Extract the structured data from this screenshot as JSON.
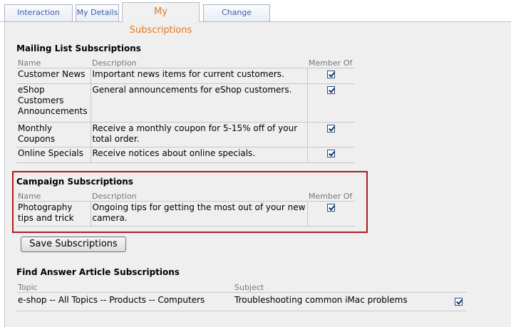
{
  "tabs": [
    {
      "label": "Interaction History"
    },
    {
      "label": "My Details"
    },
    {
      "label": "My Subscriptions"
    },
    {
      "label": "Change Password"
    }
  ],
  "mailing": {
    "title": "Mailing List Subscriptions",
    "headers": {
      "name": "Name",
      "description": "Description",
      "member": "Member Of"
    },
    "rows": [
      {
        "name": "Customer News",
        "description": "Important news items for current customers.",
        "checked": true
      },
      {
        "name": "eShop Customers Announcements",
        "description": "General announcements for eShop customers.",
        "checked": true
      },
      {
        "name": "Monthly Coupons",
        "description": "Receive a monthly coupon for 5-15% off of your total order.",
        "checked": true
      },
      {
        "name": "Online Specials",
        "description": "Receive notices about online specials.",
        "checked": true
      }
    ]
  },
  "campaign": {
    "title": "Campaign Subscriptions",
    "headers": {
      "name": "Name",
      "description": "Description",
      "member": "Member Of"
    },
    "rows": [
      {
        "name": "Photography tips and trick",
        "description": "Ongoing tips for getting the most out of your new camera.",
        "checked": true
      }
    ]
  },
  "save_button": "Save Subscriptions",
  "answers": {
    "title": "Find Answer Article Subscriptions",
    "headers": {
      "topic": "Topic",
      "subject": "Subject"
    },
    "rows": [
      {
        "topic": "e-shop -- All Topics -- Products -- Computers",
        "subject": "Troubleshooting common iMac problems",
        "checked": true
      }
    ]
  }
}
